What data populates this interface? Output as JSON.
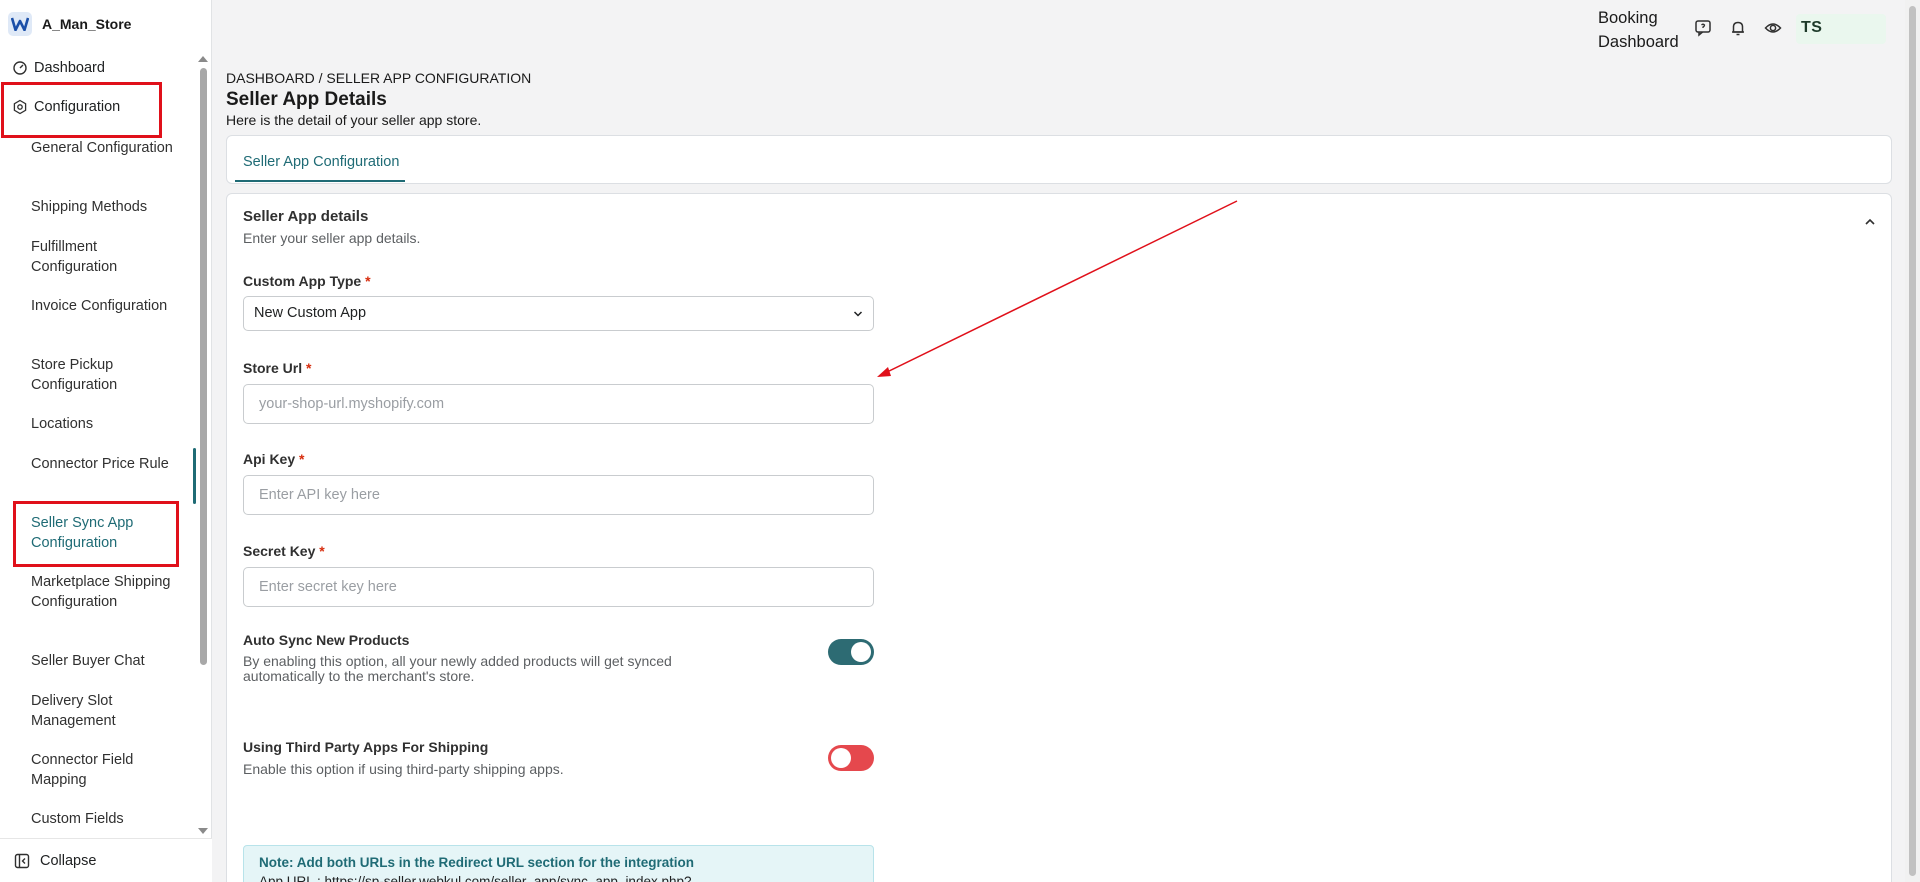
{
  "brand": {
    "name": "A_Man_Store"
  },
  "sidebar": {
    "dashboard": "Dashboard",
    "configuration": "Configuration",
    "items": [
      {
        "label": "General Configuration"
      },
      {
        "label": "Shipping Methods"
      },
      {
        "label": "Fulfillment Configuration"
      },
      {
        "label": "Invoice Configuration"
      },
      {
        "label": "Store Pickup Configuration"
      },
      {
        "label": "Locations"
      },
      {
        "label": "Connector Price Rule"
      },
      {
        "label": "Seller Sync App Configuration"
      },
      {
        "label": "Marketplace Shipping Configuration"
      },
      {
        "label": "Seller Buyer Chat"
      },
      {
        "label": "Delivery Slot Management"
      },
      {
        "label": "Connector Field Mapping"
      },
      {
        "label": "Custom Fields"
      }
    ],
    "collapse": "Collapse"
  },
  "header": {
    "booking_line1": "Booking",
    "booking_line2": "Dashboard",
    "avatar_initials": "TS"
  },
  "page": {
    "breadcrumb": "DASHBOARD / SELLER APP CONFIGURATION",
    "title": "Seller App Details",
    "subtitle": "Here is the detail of your seller app store.",
    "tab": "Seller App Configuration"
  },
  "section": {
    "title": "Seller App details",
    "subtitle": "Enter your seller app details.",
    "custom_app_type_label": "Custom App Type",
    "custom_app_type_value": "New Custom App",
    "store_url_label": "Store Url",
    "store_url_placeholder": "your-shop-url.myshopify.com",
    "api_key_label": "Api Key",
    "api_key_placeholder": "Enter API key here",
    "secret_key_label": "Secret Key",
    "secret_key_placeholder": "Enter secret key here",
    "required_mark": "*",
    "auto_sync_title": "Auto Sync New Products",
    "auto_sync_desc_1": "By enabling this option, all your newly added products will get synced",
    "auto_sync_desc_2": "automatically to the merchant's store.",
    "auto_sync_on": true,
    "third_party_title": "Using Third Party Apps For Shipping",
    "third_party_desc": "Enable this option if using third-party shipping apps.",
    "third_party_on": false,
    "note_title": "Note: Add both URLs in the Redirect URL section for the integration",
    "note_line": "App URL : https://sp-seller.webkul.com/seller_app/sync_app_index.php?"
  },
  "colors": {
    "accent": "#1f6b75",
    "highlight": "#e0101a",
    "toggle_off": "#e5484d"
  }
}
